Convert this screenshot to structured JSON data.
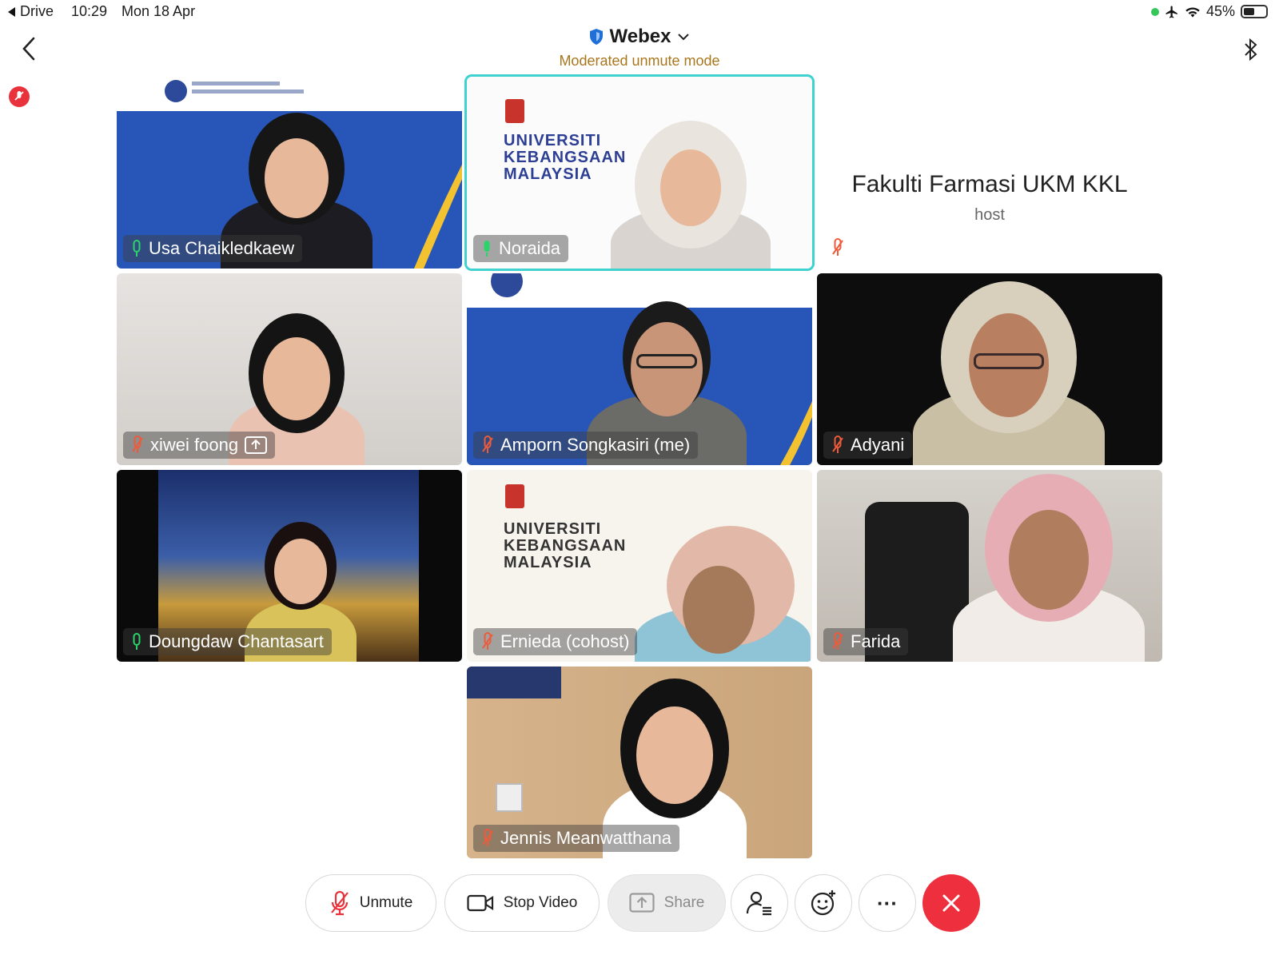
{
  "status_bar": {
    "back_app": "Drive",
    "time": "10:29",
    "date": "Mon 18 Apr",
    "battery": "45%"
  },
  "header": {
    "title": "Webex",
    "subtitle": "Moderated unmute mode"
  },
  "participants": [
    {
      "name": "Usa Chaikledkaew",
      "mic": "on"
    },
    {
      "name": "Noraida",
      "mic": "on",
      "active_speaker": true
    },
    {
      "name": "Fakulti Farmasi UKM KKL",
      "role": "host",
      "mic": "muted",
      "video": "off"
    },
    {
      "name": "xiwei foong",
      "mic": "muted",
      "sharing": true
    },
    {
      "name": "Amporn Songkasiri (me)",
      "mic": "muted"
    },
    {
      "name": "Adyani",
      "mic": "muted"
    },
    {
      "name": "Doungdaw Chantasart",
      "mic": "on"
    },
    {
      "name": "Ernieda (cohost)",
      "mic": "muted"
    },
    {
      "name": "Farida",
      "mic": "muted"
    },
    {
      "name": "Jennis Meanwatthana",
      "mic": "muted"
    }
  ],
  "backgrounds": {
    "ukm_line1": "UNIVERSITI",
    "ukm_line2": "KEBANGSAAN",
    "ukm_line3": "MALAYSIA"
  },
  "toolbar": {
    "unmute_label": "Unmute",
    "stop_video_label": "Stop Video",
    "share_label": "Share",
    "more_label": "···"
  },
  "colors": {
    "accent_cyan": "#3fd3d0",
    "muted_red": "#ee5b3b",
    "mic_on_green": "#2bd46a",
    "end_call_red": "#ee2f3d",
    "subtitle_amber": "#a8761d"
  }
}
